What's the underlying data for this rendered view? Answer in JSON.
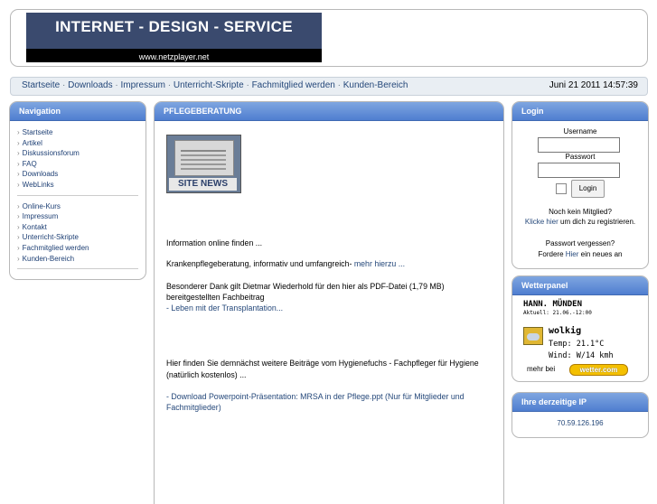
{
  "header": {
    "banner_title": "INTERNET - DESIGN - SERVICE",
    "banner_subtitle": "www.netzplayer.net"
  },
  "topnav": {
    "links": [
      "Startseite",
      "Downloads",
      "Impressum",
      "Unterricht-Skripte",
      "Fachmitglied werden",
      "Kunden-Bereich"
    ],
    "separator": " · ",
    "datetime": "Juni 21 2011 14:57:39"
  },
  "navigation": {
    "title": "Navigation",
    "group1": [
      "Startseite",
      "Artikel",
      "Diskussionsforum",
      "FAQ",
      "Downloads",
      "WebLinks"
    ],
    "group2": [
      "Online-Kurs",
      "Impressum",
      "Kontakt",
      "Unterricht-Skripte",
      "Fachmitglied werden",
      "Kunden-Bereich"
    ]
  },
  "main": {
    "title": "PFLEGEBERATUNG",
    "image_label": "SITE NEWS",
    "p1": "Information online finden ...",
    "p2_text": "Krankenpflegeberatung, informativ und umfangreich- ",
    "p2_link": "mehr hierzu ...",
    "p3_text": "Besonderer Dank gilt Dietmar Wiederhold für den hier als PDF-Datei (1,79 MB) bereitgestellten Fachbeitrag",
    "p3_link": "- Leben mit der Transplantation...",
    "p4_text": "Hier finden Sie demnächst weitere Beiträge vom Hygienefuchs - Fachpfleger für Hygiene",
    "p4_note": "(natürlich kostenlos) ...",
    "p5_link": "- Download Powerpoint-Präsentation: MRSA in der Pflege.ppt (Nur für Mitglieder und Fachmitglieder)"
  },
  "login": {
    "title": "Login",
    "username_label": "Username",
    "password_label": "Passwort",
    "button": "Login",
    "no_member": "Noch kein Mitglied?",
    "click_link": "Klicke hier",
    "register_text": " um dich zu registrieren.",
    "forgot": "Passwort vergessen?",
    "request_prefix": "Fordere ",
    "request_link": "Hier",
    "request_suffix": " ein neues an"
  },
  "weather": {
    "title": "Wetterpanel",
    "city": "HANN. MÜNDEN",
    "updated": "Aktuell: 21.06.-12:00",
    "condition": "wolkig",
    "temp": "Temp: 21.1°C",
    "wind": "Wind: W/14 kmh",
    "more": "mehr bei",
    "provider": "wetter.com"
  },
  "ip": {
    "title": "Ihre derzeitige IP",
    "value": "70.59.126.196"
  }
}
